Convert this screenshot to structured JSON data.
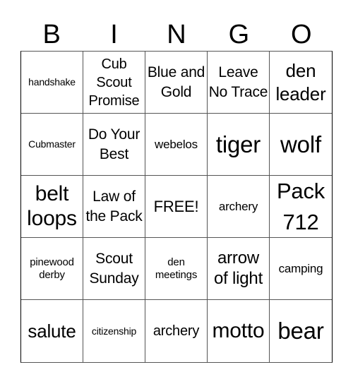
{
  "header": {
    "letters": [
      "B",
      "I",
      "N",
      "G",
      "O"
    ]
  },
  "board": {
    "cells": [
      [
        "handshake",
        "Cub Scout Promise",
        "Blue and Gold",
        "Leave No Trace",
        "den leader"
      ],
      [
        "Cubmaster",
        "Do Your Best",
        "webelos",
        "tiger",
        "wolf"
      ],
      [
        "belt loops",
        "Law of the Pack",
        "FREE!",
        "archery",
        "Pack 712"
      ],
      [
        "pinewood derby",
        "Scout Sunday",
        "den meetings",
        "arrow of light",
        "camping"
      ],
      [
        "salute",
        "citizenship",
        "archery",
        "motto",
        "bear"
      ]
    ],
    "free_space": "FREE!"
  }
}
